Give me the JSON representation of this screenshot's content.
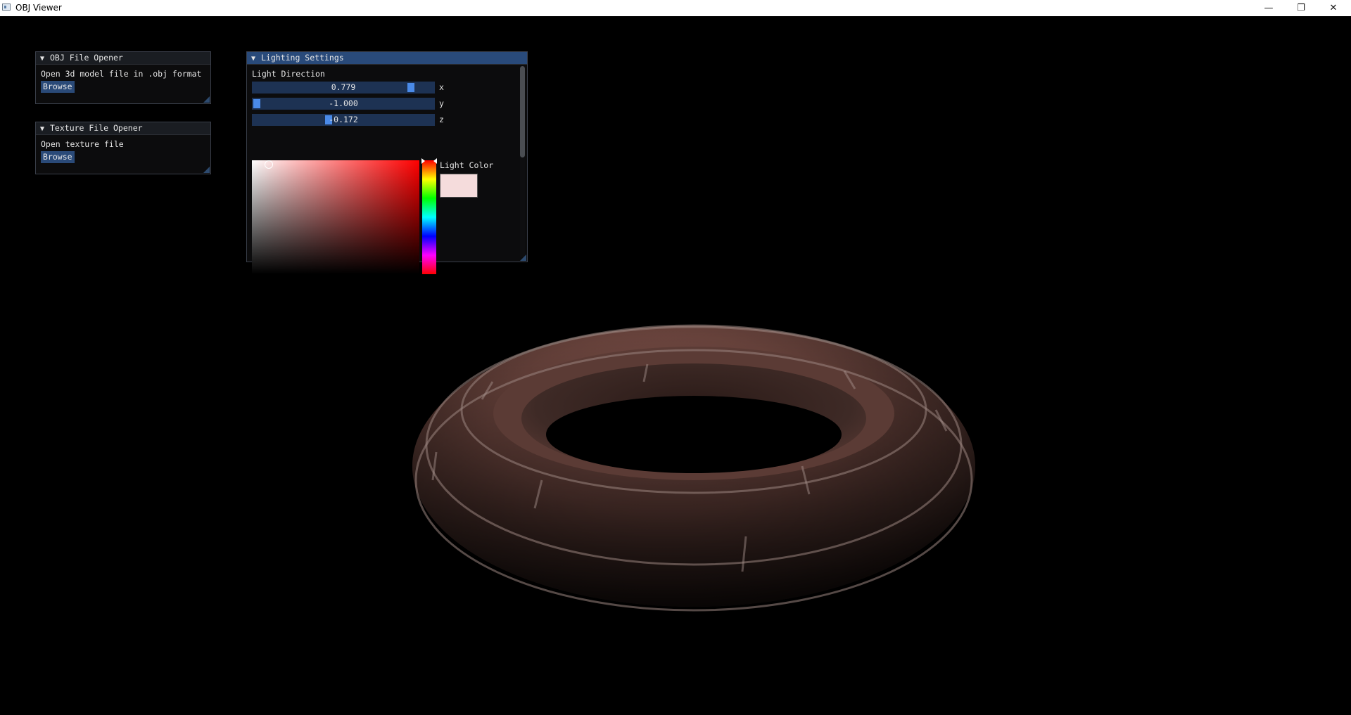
{
  "window": {
    "title": "OBJ Viewer",
    "controls": {
      "minimize": "—",
      "restore": "❐",
      "close": "✕"
    }
  },
  "obj_panel": {
    "title": "OBJ File Opener",
    "description": "Open 3d model file in .obj format",
    "button": "Browse"
  },
  "texture_panel": {
    "title": "Texture File Opener",
    "description": "Open texture file",
    "button": "Browse"
  },
  "lighting_panel": {
    "title": "Lighting Settings",
    "direction_label": "Light Direction",
    "sliders": [
      {
        "axis": "x",
        "value": "0.779",
        "fraction": 0.889
      },
      {
        "axis": "y",
        "value": "-1.000",
        "fraction": 0.0
      },
      {
        "axis": "z",
        "value": "-0.172",
        "fraction": 0.414
      }
    ],
    "color_label": "Light Color",
    "light_color": "#f5dcdc",
    "hue_color": "#ff0000",
    "accent": "#4a8ae8"
  },
  "icons": {
    "collapse": "triangle-down-icon",
    "app": "app-window-icon"
  }
}
